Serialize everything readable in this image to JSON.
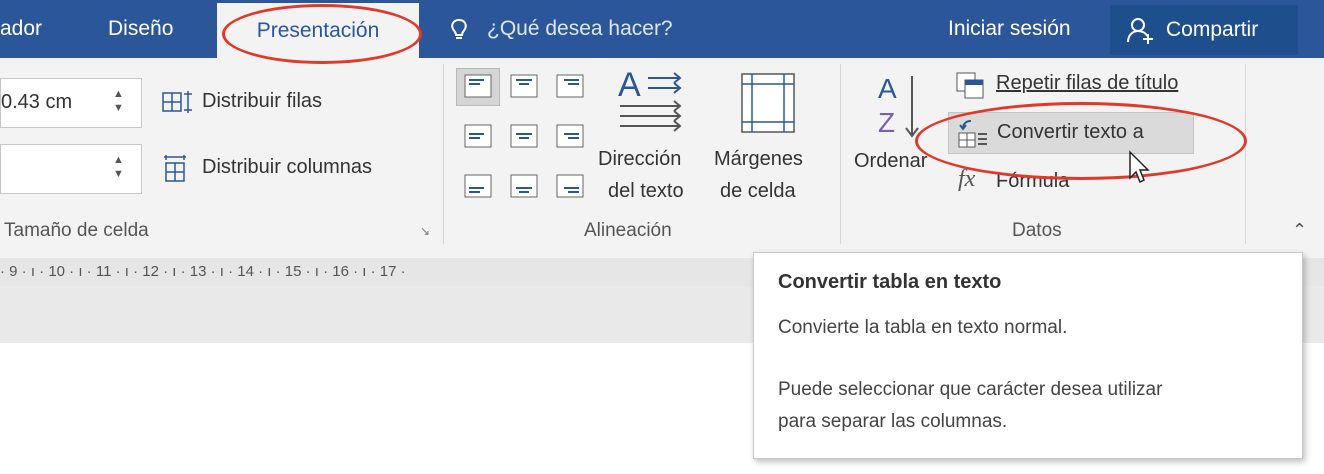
{
  "tabs": {
    "insert_partial": "ador",
    "design": "Diseño",
    "layout": "Presentación",
    "tell_me": "¿Qué desea hacer?",
    "sign_in": "Iniciar sesión",
    "share": "Compartir"
  },
  "cell_size": {
    "height_value": "0.43 cm",
    "width_value": "",
    "distribute_rows": "Distribuir filas",
    "distribute_columns": "Distribuir columnas",
    "group_label": "Tamaño de celda"
  },
  "alignment": {
    "text_direction_line1": "Dirección",
    "text_direction_line2": "del texto",
    "cell_margins_line1": "Márgenes",
    "cell_margins_line2": "de celda",
    "group_label": "Alineación"
  },
  "data": {
    "sort": "Ordenar",
    "repeat_header_rows": "Repetir filas de título",
    "convert_to_text": "Convertir texto a",
    "formula": "Fórmula",
    "group_label": "Datos"
  },
  "ruler": {
    "text": "· 9 · ı · 10 · ı · 11 · ı · 12 · ı · 13 · ı · 14 · ı · 15 · ı · 16 · ı · 17 ·"
  },
  "tooltip": {
    "title": "Convertir tabla en texto",
    "line1": "Convierte la tabla en texto normal.",
    "line2": "Puede seleccionar que carácter desea utilizar",
    "line3": "para separar las columnas."
  },
  "colors": {
    "accent": "#2b579a",
    "highlight_ellipse": "#e0392a"
  }
}
